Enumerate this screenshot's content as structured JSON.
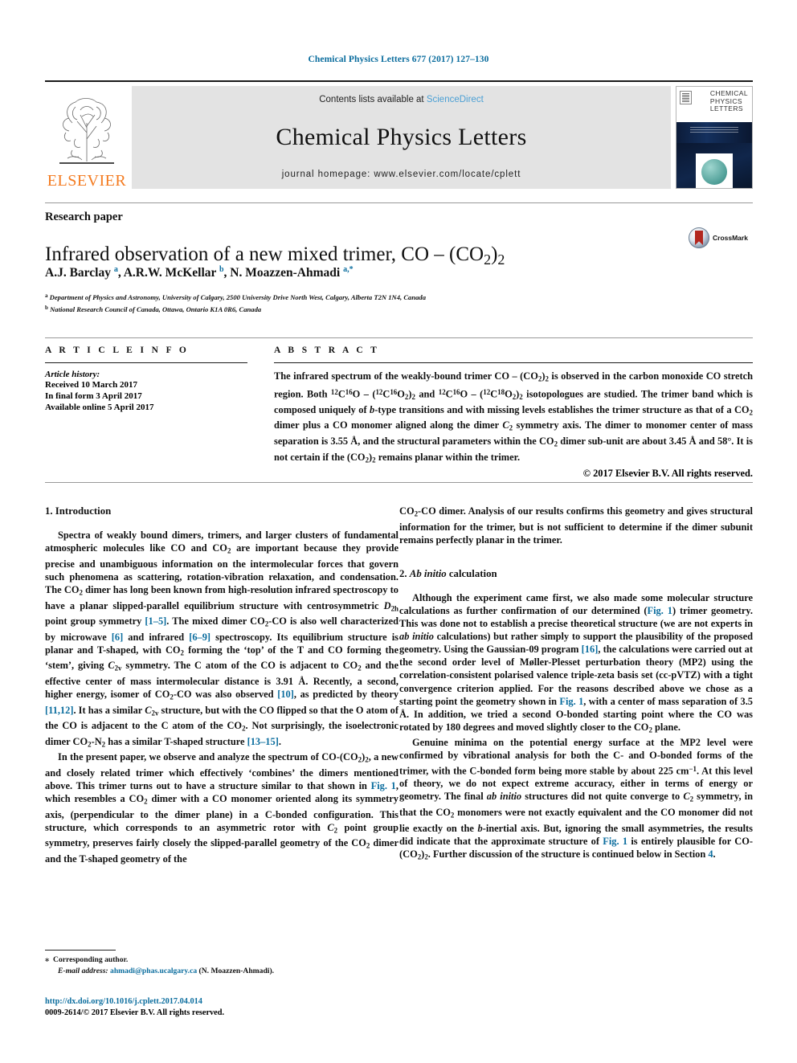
{
  "running_head": "Chemical Physics Letters 677 (2017) 127–130",
  "masthead": {
    "contents_prefix": "Contents lists available at ",
    "sciencedirect": "ScienceDirect",
    "journal_name": "Chemical Physics Letters",
    "homepage": "journal homepage: www.elsevier.com/locate/cplett",
    "publisher_logo_text": "ELSEVIER",
    "cover_title_line1": "CHEMICAL",
    "cover_title_line2": "PHYSICS",
    "cover_title_line3": "LETTERS"
  },
  "article": {
    "kind": "Research paper",
    "title_html": "Infrared observation of a new mixed trimer, CO – (CO<sub>2</sub>)<sub>2</sub>",
    "authors_html": "A.J. Barclay <span class=\"aff\">a</span>, A.R.W. McKellar <span class=\"aff\">b</span>, N. Moazzen-Ahmadi <span class=\"aff\">a,*</span>",
    "affiliation_a": "Department of Physics and Astronomy, University of Calgary, 2500 University Drive North West, Calgary, Alberta T2N 1N4, Canada",
    "affiliation_b": "National Research Council of Canada, Ottawa, Ontario K1A 0R6, Canada",
    "crossmark_label": "CrossMark"
  },
  "article_info": {
    "heading": "A R T I C L E   I N F O",
    "history_label": "Article history:",
    "history": [
      "Received 10 March 2017",
      "In final form 3 April 2017",
      "Available online 5 April 2017"
    ]
  },
  "abstract": {
    "heading": "A B S T R A C T",
    "body_html": "The infrared spectrum of the weakly-bound trimer CO – (CO<sub>2</sub>)<sub>2</sub> is observed in the carbon monoxide CO stretch region. Both <sup>12</sup>C<sup>16</sup>O – (<sup>12</sup>C<sup>16</sup>O<sub>2</sub>)<sub>2</sub> and <sup>12</sup>C<sup>16</sup>O – (<sup>12</sup>C<sup>18</sup>O<sub>2</sub>)<sub>2</sub> isotopologues are studied. The trimer band which is composed uniquely of <span class=\"it\">b</span>-type transitions and with missing levels establishes the trimer structure as that of a CO<sub>2</sub> dimer plus a CO monomer aligned along the dimer <span class=\"it\">C</span><sub>2</sub> symmetry axis. The dimer to monomer center of mass separation is 3.55 Å, and the structural parameters within the CO<sub>2</sub> dimer sub-unit are about 3.45 Å and 58°. It is not certain if the (CO<sub>2</sub>)<sub>2</sub> remains planar within the trimer.",
    "copyright": "© 2017 Elsevier B.V. All rights reserved."
  },
  "sections": {
    "intro_heading": "1. Introduction",
    "intro_p1_html": "Spectra of weakly bound dimers, trimers, and larger clusters of fundamental atmospheric molecules like CO and CO<sub>2</sub> are important because they provide precise and unambiguous information on the intermolecular forces that govern such phenomena as scattering, rotation-vibration relaxation, and condensation. The CO<sub>2</sub> dimer has long been known from high-resolution infrared spectroscopy to have a planar slipped-parallel equilibrium structure with centrosymmetric <span class=\"it\">D</span><sub>2h</sub> point group symmetry <span class=\"ref\">[1–5]</span>. The mixed dimer CO<sub>2</sub>-CO is also well characterized by microwave <span class=\"ref\">[6]</span> and infrared <span class=\"ref\">[6–9]</span> spectroscopy. Its equilibrium structure is planar and T-shaped, with CO<sub>2</sub> forming the ‘top’ of the T and CO forming the ‘stem’, giving <span class=\"it\">C</span><sub>2v</sub> symmetry. The C atom of the CO is adjacent to CO<sub>2</sub> and the effective center of mass intermolecular distance is 3.91 Å. Recently, a second, higher energy, isomer of CO<sub>2</sub>-CO was also observed <span class=\"ref\">[10]</span>, as predicted by theory <span class=\"ref\">[11,12]</span>. It has a similar <span class=\"it\">C</span><sub>2v</sub> structure, but with the CO flipped so that the O atom of the CO is adjacent to the C atom of the CO<sub>2</sub>. Not surprisingly, the isoelectronic dimer CO<sub>2</sub>-N<sub>2</sub> has a similar T-shaped structure <span class=\"ref\">[13–15]</span>.",
    "intro_p2_html": "In the present paper, we observe and analyze the spectrum of CO-(CO<sub>2</sub>)<sub>2</sub>, a new and closely related trimer which effectively ‘combines’ the dimers mentioned above. This trimer turns out to have a structure similar to that shown in <span class=\"ref\">Fig. 1</span>, which resembles a CO<sub>2</sub> dimer with a CO monomer oriented along its symmetry axis, (perpendicular to the dimer plane) in a C-bonded configuration. This structure, which corresponds to an asymmetric rotor with <span class=\"it\">C</span><sub>2</sub> point group symmetry, preserves fairly closely the slipped-parallel geometry of the CO<sub>2</sub> dimer and the T-shaped geometry of the",
    "right_p0_html": "CO<sub>2</sub>-CO dimer. Analysis of our results confirms this geometry and gives structural information for the trimer, but is not sufficient to determine if the dimer subunit remains perfectly planar in the trimer.",
    "abinitio_heading_html": "2. <span class=\"it\">Ab initio</span> calculation",
    "abinitio_p1_html": "Although the experiment came first, we also made some molecular structure calculations as further confirmation of our determined (<span class=\"ref\">Fig. 1</span>) trimer geometry. This was done not to establish a precise theoretical structure (we are not experts in <span class=\"it\">ab initio</span> calculations) but rather simply to support the plausibility of the proposed geometry. Using the Gaussian-09 program <span class=\"ref\">[16]</span>, the calculations were carried out at the second order level of Møller-Plesset perturbation theory (MP2) using the correlation-consistent polarised valence triple-zeta basis set (cc-pVTZ) with a tight convergence criterion applied. For the reasons described above we chose as a starting point the geometry shown in <span class=\"ref\">Fig. 1</span>, with a center of mass separation of 3.5 Å. In addition, we tried a second O-bonded starting point where the CO was rotated by 180 degrees and moved slightly closer to the CO<sub>2</sub> plane.",
    "abinitio_p2_html": "Genuine minima on the potential energy surface at the MP2 level were confirmed by vibrational analysis for both the C- and O-bonded forms of the trimer, with the C-bonded form being more stable by about 225 cm<sup>−1</sup>. At this level of theory, we do not expect extreme accuracy, either in terms of energy or geometry. The final <span class=\"it\">ab initio</span> structures did not quite converge to <span class=\"it\">C</span><sub>2</sub> symmetry, in that the CO<sub>2</sub> monomers were not exactly equivalent and the CO monomer did not lie exactly on the <span class=\"it\">b</span>-inertial axis. But, ignoring the small asymmetries, the results did indicate that the approximate structure of <span class=\"ref\">Fig. 1</span> is entirely plausible for CO-(CO<sub>2</sub>)<sub>2</sub>. Further discussion of the structure is continued below in Section <span class=\"ref\">4</span>."
  },
  "footer": {
    "corresponding_html": "<span class=\"star\">⁎</span>&nbsp; Corresponding author.",
    "email_html": "<span class=\"em-label\">E-mail address:</span> <span class=\"ref\">ahmadi@phas.ucalgary.ca</span> (N. Moazzen-Ahmadi).",
    "doi_html": "<span class=\"link\">http://dx.doi.org/10.1016/j.cplett.2017.04.014</span>",
    "issn_html": "0009-2614/© 2017 Elsevier B.V. All rights reserved."
  },
  "colors": {
    "link": "#0b6d9e",
    "sciencedirect": "#4a9fd4",
    "elsevier_orange": "#f47b20",
    "mast_bg": "#e3e3e3"
  }
}
